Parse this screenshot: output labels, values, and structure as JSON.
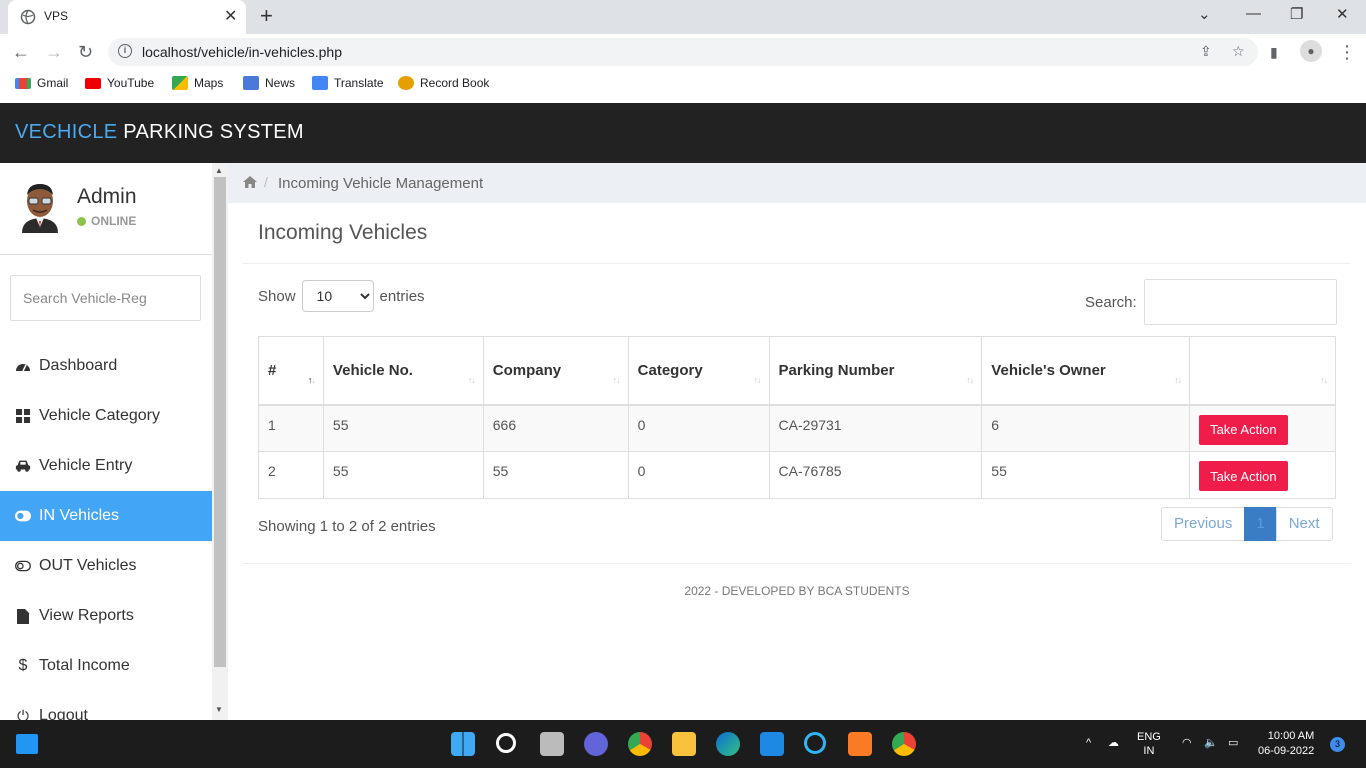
{
  "browser": {
    "tab_title": "VPS",
    "url": "localhost/vehicle/in-vehicles.php",
    "bookmarks": [
      "Gmail",
      "YouTube",
      "Maps",
      "News",
      "Translate",
      "Record Book"
    ]
  },
  "header": {
    "brand_part1": "VECHICLE",
    "brand_part2": "PARKING SYSTEM"
  },
  "sidebar": {
    "user_name": "Admin",
    "user_status": "ONLINE",
    "search_placeholder": "Search Vehicle-Reg",
    "items": [
      {
        "label": "Dashboard",
        "icon": "dashboard-icon"
      },
      {
        "label": "Vehicle Category",
        "icon": "grid-icon"
      },
      {
        "label": "Vehicle Entry",
        "icon": "car-icon"
      },
      {
        "label": "IN Vehicles",
        "icon": "toggle-on-icon",
        "active": true
      },
      {
        "label": "OUT Vehicles",
        "icon": "toggle-off-icon"
      },
      {
        "label": "View Reports",
        "icon": "file-icon"
      },
      {
        "label": "Total Income",
        "icon": "dollar-icon"
      },
      {
        "label": "Logout",
        "icon": "power-icon"
      }
    ]
  },
  "main": {
    "breadcrumb": "Incoming Vehicle Management",
    "page_title": "Incoming Vehicles",
    "show_label": "Show",
    "show_value": "10",
    "entries_label": "entries",
    "search_label": "Search:",
    "table": {
      "headers": [
        "#",
        "Vehicle No.",
        "Company",
        "Category",
        "Parking Number",
        "Vehicle's Owner",
        ""
      ],
      "rows": [
        [
          "1",
          "55",
          "666",
          "0",
          "CA-29731",
          "6"
        ],
        [
          "2",
          "55",
          "55",
          "0",
          "CA-76785",
          "55"
        ]
      ],
      "action_label": "Take Action"
    },
    "info": "Showing 1 to 2 of 2 entries",
    "pager": {
      "prev": "Previous",
      "current": "1",
      "next": "Next"
    },
    "footer": "2022 - DEVELOPED BY BCA STUDENTS"
  },
  "taskbar": {
    "lang1": "ENG",
    "lang2": "IN",
    "time": "10:00 AM",
    "date": "06-09-2022",
    "notifications": "3"
  },
  "colors": {
    "accent": "#42a5f5",
    "danger": "#f01c4a",
    "header_bg": "#222222"
  }
}
